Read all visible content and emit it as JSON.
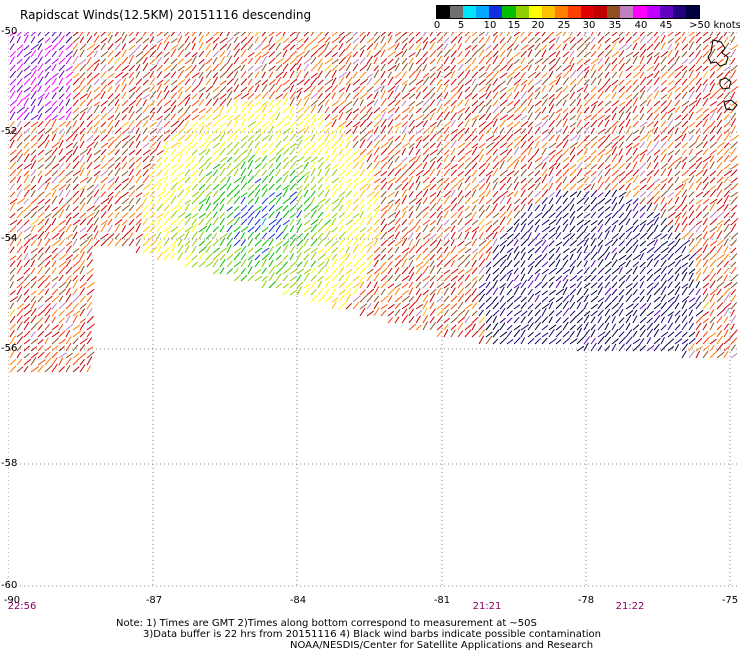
{
  "title": "Rapidscat Winds(12.5KM) 20151116 descending",
  "legend": {
    "labels": [
      "0",
      "5",
      "10",
      "15",
      "20",
      "25",
      "30",
      "35",
      "40",
      "45",
      ">50 knots"
    ],
    "colors": [
      "#000000",
      "#707070",
      "#00e5ff",
      "#00a8ff",
      "#1030e0",
      "#00c000",
      "#90d000",
      "#ffff00",
      "#ffc000",
      "#ff8000",
      "#ff4000",
      "#e00000",
      "#c00000",
      "#905020",
      "#c080c0",
      "#ff00ff",
      "#c000ff",
      "#6000c0",
      "#200080",
      "#000040"
    ]
  },
  "axes": {
    "lat_labels": [
      "-50",
      "-52",
      "-54",
      "-56",
      "-58",
      "-60"
    ],
    "lon_labels": [
      "-90",
      "-87",
      "-84",
      "-81",
      "-78",
      "-75"
    ]
  },
  "times": [
    "22:56",
    "21:21",
    "21:22"
  ],
  "notes": {
    "line1": "Note: 1) Times are GMT 2)Times along bottom correspond to measurement at ~50S",
    "line2": "3)Data buffer is 22 hrs from 20151116 4) Black wind barbs indicate possible contamination",
    "line3": "NOAA/NESDIS/Center for Satellite Applications and Research"
  }
}
